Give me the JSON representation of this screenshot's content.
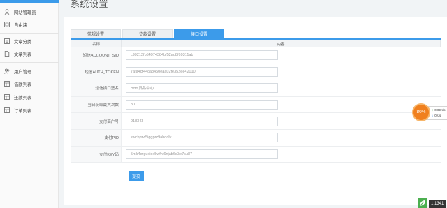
{
  "sidebar": {
    "items": [
      {
        "label": "网站管理员",
        "icon": "user-icon"
      },
      {
        "label": "自由块",
        "icon": "block-icon"
      },
      {
        "label": "文章分类",
        "icon": "list-icon"
      },
      {
        "label": "文章列表",
        "icon": "document-icon"
      },
      {
        "label": "用户管理",
        "icon": "users-icon"
      },
      {
        "label": "借款列表",
        "icon": "grid-icon"
      },
      {
        "label": "还款列表",
        "icon": "grid-icon"
      },
      {
        "label": "订单列表",
        "icon": "grid-icon"
      }
    ],
    "accent": "#3c9bea"
  },
  "page": {
    "title": "系统设置"
  },
  "tabs": [
    {
      "label": "常规设置",
      "active": false
    },
    {
      "label": "贷款设置",
      "active": false
    },
    {
      "label": "接口设置",
      "active": true
    }
  ],
  "table": {
    "headers": {
      "name": "名称",
      "content": "内容"
    },
    "rows": [
      {
        "label": "短信ACCOUNT_SID",
        "value": "c99212fb54974384bf52ad8f69311ab"
      },
      {
        "label": "短信AUTH_TOKEN",
        "value": "7afa4cf44ca8450eaa02fe352ee42010"
      },
      {
        "label": "短信接口签名",
        "value": "Bom贷品中心"
      },
      {
        "label": "当日获取最大次数",
        "value": "30"
      },
      {
        "label": "支付商户号",
        "value": "918343"
      },
      {
        "label": "支付PID",
        "value": "swchpwt5iggprz9ahddlv"
      },
      {
        "label": "支付KEY码",
        "value": "5mk4erguxiox5wfht6njab6q3e7su87"
      }
    ]
  },
  "submit_label": "提交",
  "speed_widget": {
    "percent": "80%",
    "upload": "0.09K/s",
    "download": "0K/s"
  },
  "badge": {
    "number": "1.1341"
  }
}
